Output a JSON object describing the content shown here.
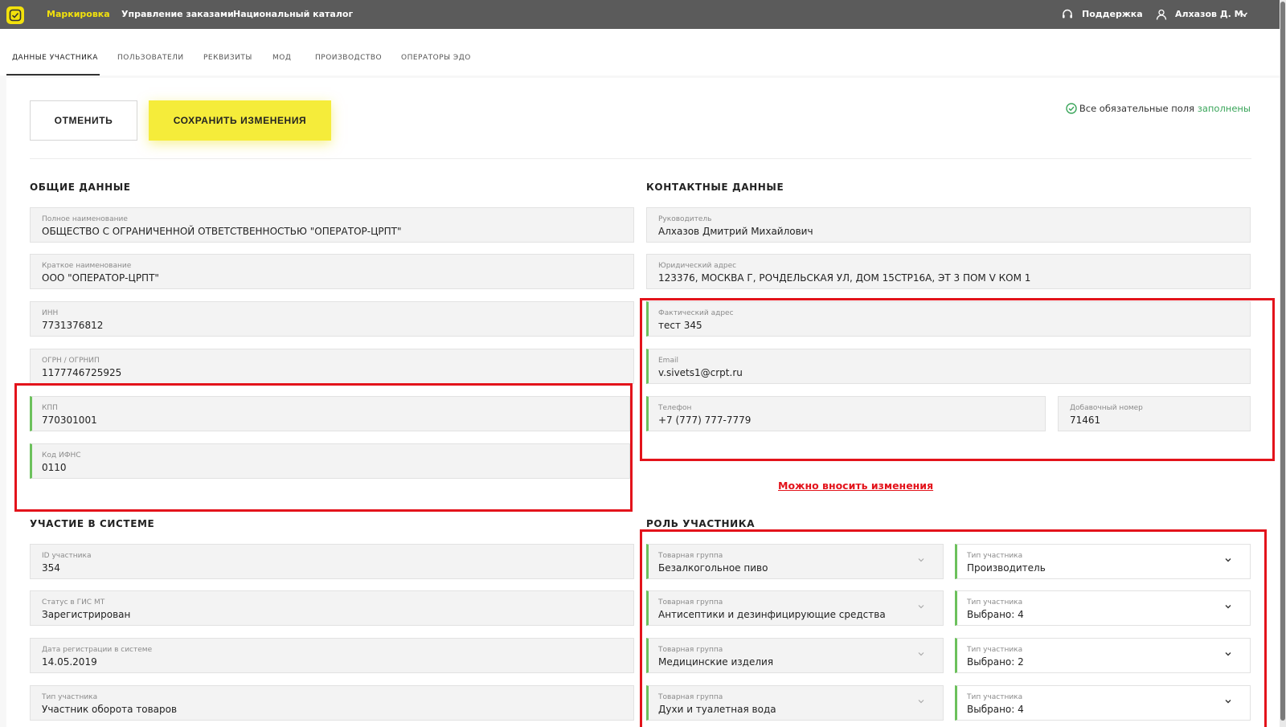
{
  "topbar": {
    "nav": [
      "Маркировка",
      "Управление заказами",
      "Национальный каталог"
    ],
    "support": "Поддержка",
    "user": "Алхазов Д. М."
  },
  "tabs": [
    "Данные участника",
    "Пользователи",
    "Реквизиты",
    "МОД",
    "Производство",
    "Операторы ЭДО"
  ],
  "actions": {
    "cancel": "Отменить",
    "save": "Сохранить изменения"
  },
  "status": {
    "text": "Все обязательные поля",
    "ok": "заполнены"
  },
  "general": {
    "title": "Общие данные",
    "fields": [
      {
        "label": "Полное наименование",
        "value": "ОБЩЕСТВО С ОГРАНИЧЕННОЙ ОТВЕТСТВЕННОСТЬЮ \"ОПЕРАТОР-ЦРПТ\""
      },
      {
        "label": "Краткое наименование",
        "value": "ООО \"ОПЕРАТОР-ЦРПТ\""
      },
      {
        "label": "ИНН",
        "value": "7731376812"
      },
      {
        "label": "ОГРН / ОГРНИП",
        "value": "1177746725925"
      },
      {
        "label": "КПП",
        "value": "770301001"
      },
      {
        "label": "Код ИФНС",
        "value": "0110"
      }
    ]
  },
  "participation": {
    "title": "Участие в системе",
    "fields": [
      {
        "label": "ID участника",
        "value": "354"
      },
      {
        "label": "Статус в ГИС МТ",
        "value": "Зарегистрирован"
      },
      {
        "label": "Дата регистрации в системе",
        "value": "14.05.2019"
      },
      {
        "label": "Тип участника",
        "value": "Участник оборота товаров"
      }
    ]
  },
  "contacts": {
    "title": "Контактные данные",
    "fields": [
      {
        "label": "Руководитель",
        "value": "Алхазов Дмитрий Михайлович"
      },
      {
        "label": "Юридический адрес",
        "value": "123376, МОСКВА Г, РОЧДЕЛЬСКАЯ УЛ, ДОМ 15СТР16А, ЭТ 3 ПОМ V КОМ 1"
      },
      {
        "label": "Фактический адрес",
        "value": "тест 345"
      },
      {
        "label": "Email",
        "value": "v.sivets1@crpt.ru"
      },
      {
        "label": "Телефон",
        "value": "+7 (777) 777-7779"
      },
      {
        "label": "Добавочный номер",
        "value": "71461"
      }
    ]
  },
  "note": "Можно вносить изменения",
  "role": {
    "title": "Роль участника",
    "rows": [
      {
        "group_label": "Товарная группа",
        "group": "Безалкогольное пиво",
        "type_label": "Тип участника",
        "type": "Производитель"
      },
      {
        "group_label": "Товарная группа",
        "group": "Антисептики и дезинфицирующие средства",
        "type_label": "Тип участника",
        "type": "Выбрано: 4"
      },
      {
        "group_label": "Товарная группа",
        "group": "Медицинские изделия",
        "type_label": "Тип участника",
        "type": "Выбрано: 2"
      },
      {
        "group_label": "Товарная группа",
        "group": "Духи и туалетная вода",
        "type_label": "Тип участника",
        "type": "Выбрано: 4"
      }
    ]
  },
  "colors": {
    "accent": "#f5ec3a",
    "topbar": "#5b5b5b",
    "editable": "#6cc15c",
    "highlight": "#e3131b",
    "ok": "#3aa55a"
  }
}
